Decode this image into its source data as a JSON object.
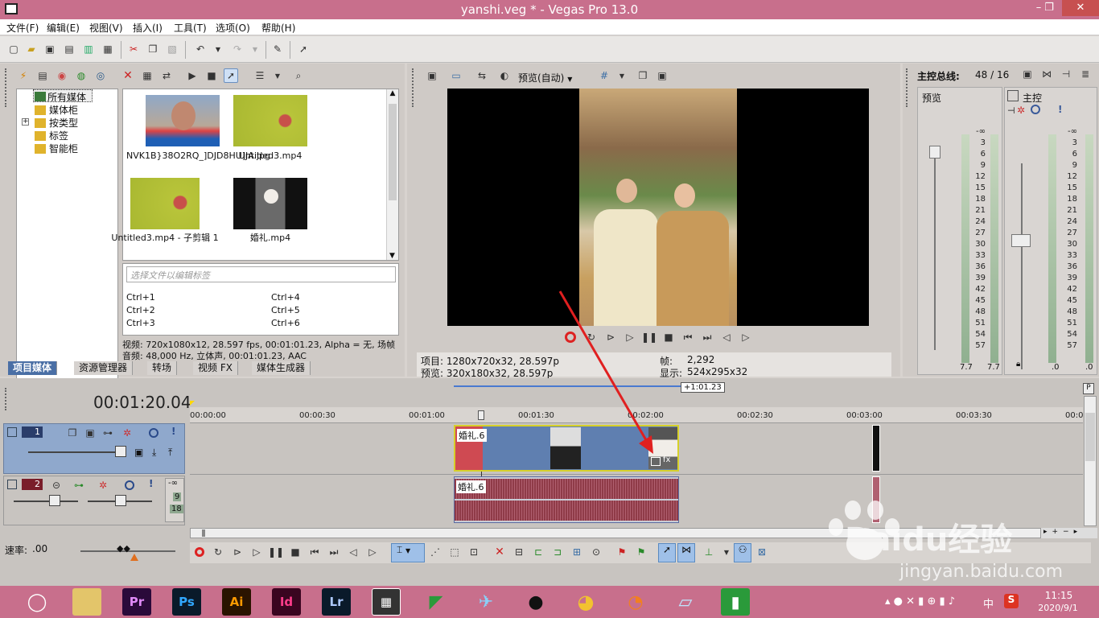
{
  "window": {
    "title": "yanshi.veg * - Vegas Pro 13.0",
    "min": "–",
    "max": "❐",
    "close": "✕"
  },
  "menu": [
    "文件(F)",
    "编辑(E)",
    "视图(V)",
    "插入(I)",
    "工具(T)",
    "选项(O)",
    "帮助(H)"
  ],
  "explorer": {
    "tree": [
      "所有媒体",
      "媒体柜",
      "按类型",
      "标签",
      "智能柜"
    ],
    "expand": "+",
    "media": [
      {
        "name": "NVK1B}38O2RQ_]DJD8HU]JA.jpg"
      },
      {
        "name": "Untitled3.mp4"
      },
      {
        "name": "Untitled3.mp4 - 子剪辑 1"
      },
      {
        "name": "婚礼.mp4"
      }
    ],
    "tag_placeholder": "选择文件以编辑标签",
    "shortcuts": [
      "Ctrl+1",
      "Ctrl+2",
      "Ctrl+3",
      "Ctrl+4",
      "Ctrl+5",
      "Ctrl+6"
    ],
    "info_video": "视频: 720x1080x12, 28.597 fps, 00:01:01.23, Alpha = 无, 场帧",
    "info_audio": "音频: 48,000 Hz, 立体声, 00:01:01.23, AAC",
    "tabs": [
      "项目媒体",
      "资源管理器",
      "转场",
      "视频 FX",
      "媒体生成器"
    ]
  },
  "preview": {
    "mode": "预览(自动)",
    "project": "项目: 1280x720x32, 28.597p",
    "preview": "预览: 320x180x32, 28.597p",
    "frame_label": "帧:",
    "frame": "2,292",
    "display_label": "显示:",
    "display": "524x295x32"
  },
  "mixer": {
    "header": "主控总线:",
    "count": "48 / 16",
    "preview_label": "预览",
    "master_label": "主控",
    "scale": [
      "-∞",
      "3",
      "6",
      "9",
      "12",
      "15",
      "18",
      "21",
      "24",
      "27",
      "30",
      "33",
      "36",
      "39",
      "42",
      "45",
      "48",
      "51",
      "54",
      "57"
    ],
    "preview_vals": [
      "7.7",
      "7.7"
    ],
    "master_vals": [
      ".0",
      ".0"
    ]
  },
  "timeline": {
    "time": "00:01:20.04",
    "region": "+1:01.23",
    "ruler": [
      "00:00:00",
      "00:00:30",
      "00:01:00",
      "00:01:30",
      "00:02:00",
      "00:02:30",
      "00:03:00",
      "00:03:30",
      "00:0"
    ],
    "track1": "1",
    "track2": "2",
    "clip_label": "婚礼.6",
    "vol_val": "-∞",
    "meter_vals": [
      "9",
      "18"
    ],
    "rate_label": "速率:",
    "rate_value": ".00"
  },
  "taskbar": {
    "apps": [
      "Pr",
      "Ps",
      "Ai",
      "Id",
      "Lr"
    ],
    "clock_time": "11:15",
    "clock_date": "2020/9/1",
    "ime": "中"
  },
  "watermark": {
    "brand": "Baidu经验",
    "url": "jingyan.baidu.com"
  },
  "colors": {
    "title": "#c86f8c",
    "clip": "#5f7fb0",
    "audio": "#8f3b48",
    "accent_red": "#e02020"
  }
}
